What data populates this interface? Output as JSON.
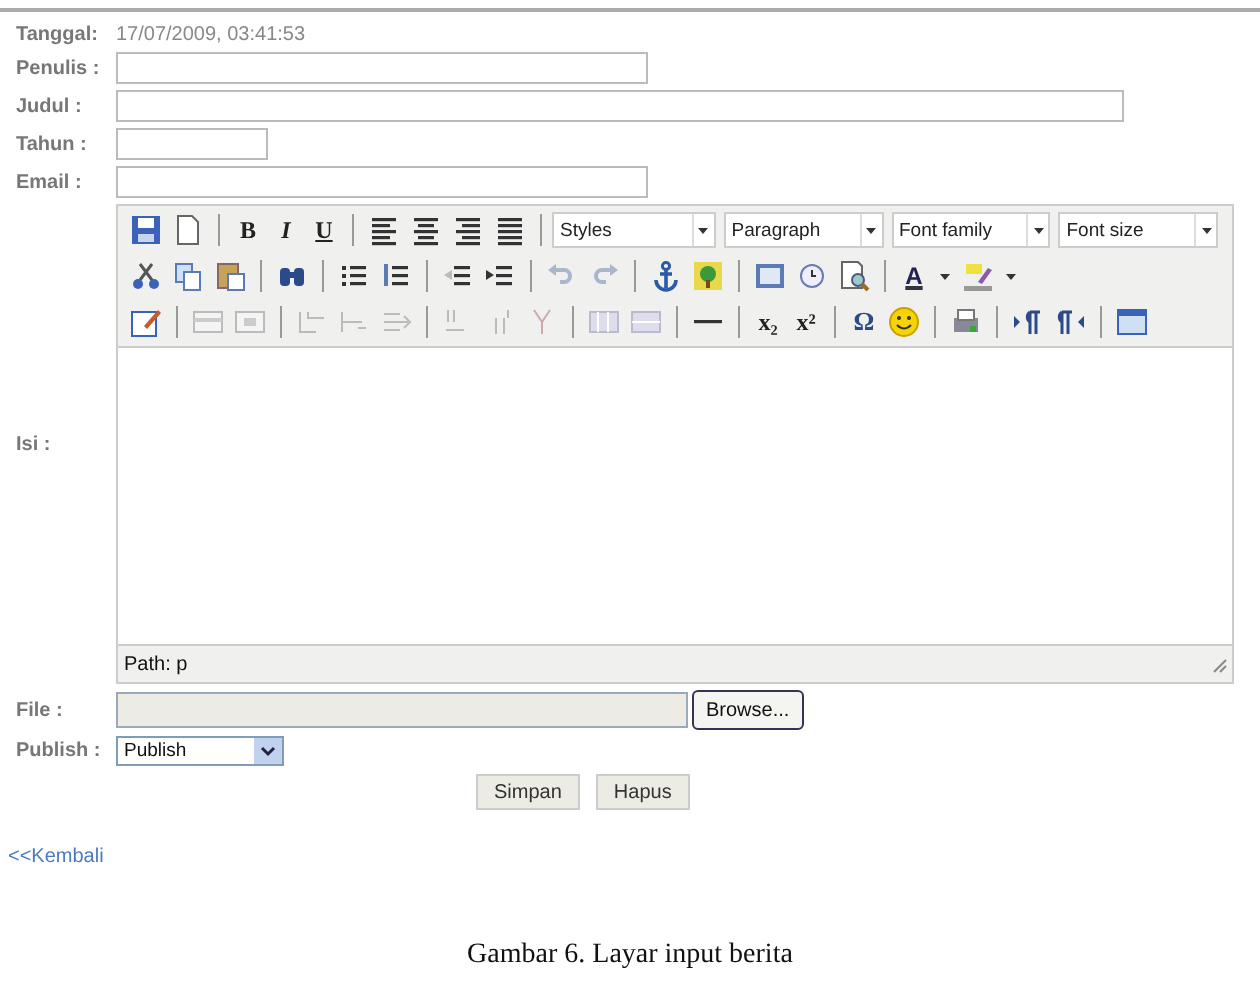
{
  "form": {
    "date_label": "Tanggal:",
    "date_value": "17/07/2009, 03:41:53",
    "fields": [
      {
        "label": "Penulis :"
      },
      {
        "label": "Judul :"
      },
      {
        "label": "Tahun :"
      },
      {
        "label": "Email :"
      }
    ],
    "editor": {
      "label": "Isi :",
      "text_buttons": [
        {
          "label": "B"
        },
        {
          "label": "I"
        },
        {
          "label": "U"
        },
        {
          "label": "A"
        },
        {
          "label": "x₂"
        },
        {
          "label": "x²"
        },
        {
          "label": "Ω"
        }
      ],
      "selects": [
        {
          "label": "Styles"
        },
        {
          "label": "Paragraph"
        },
        {
          "label": "Font family"
        },
        {
          "label": "Font size"
        }
      ],
      "path": "Path: p"
    },
    "file": {
      "label": "File :",
      "button": "Browse..."
    },
    "publish": {
      "label": "Publish :",
      "value": "Publish"
    },
    "buttons": [
      "Simpan",
      "Hapus"
    ],
    "back_link": "<<Kembali"
  },
  "caption": "Gambar 6. Layar input berita"
}
